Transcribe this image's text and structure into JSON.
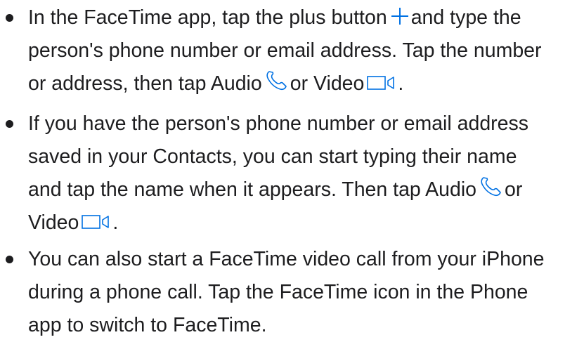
{
  "icons": {
    "plus": "plus-icon",
    "audio": "phone-icon",
    "video": "video-camera-icon"
  },
  "colors": {
    "text": "#1d1d1f",
    "icon": "#0071e3",
    "background": "#ffffff"
  },
  "items": [
    {
      "l1a": "In the FaceTime app, tap the plus button",
      "l1b": "and type the",
      "l2": "person's phone number or email address. Tap the number",
      "l3a": "or address, then tap Audio",
      "l3b": "or Video",
      "l3c": "."
    },
    {
      "l1": "If you have the person's phone number or email address",
      "l2": "saved in your Contacts, you can start typing their name",
      "l3a": "and tap the name when it appears. Then tap Audio",
      "l3b": "or",
      "l4a": "Video",
      "l4b": "."
    },
    {
      "l1": "You can also start a FaceTime video call from your iPhone",
      "l2": "during a phone call. Tap the FaceTime icon in the Phone",
      "l3": "app to switch to FaceTime."
    }
  ]
}
